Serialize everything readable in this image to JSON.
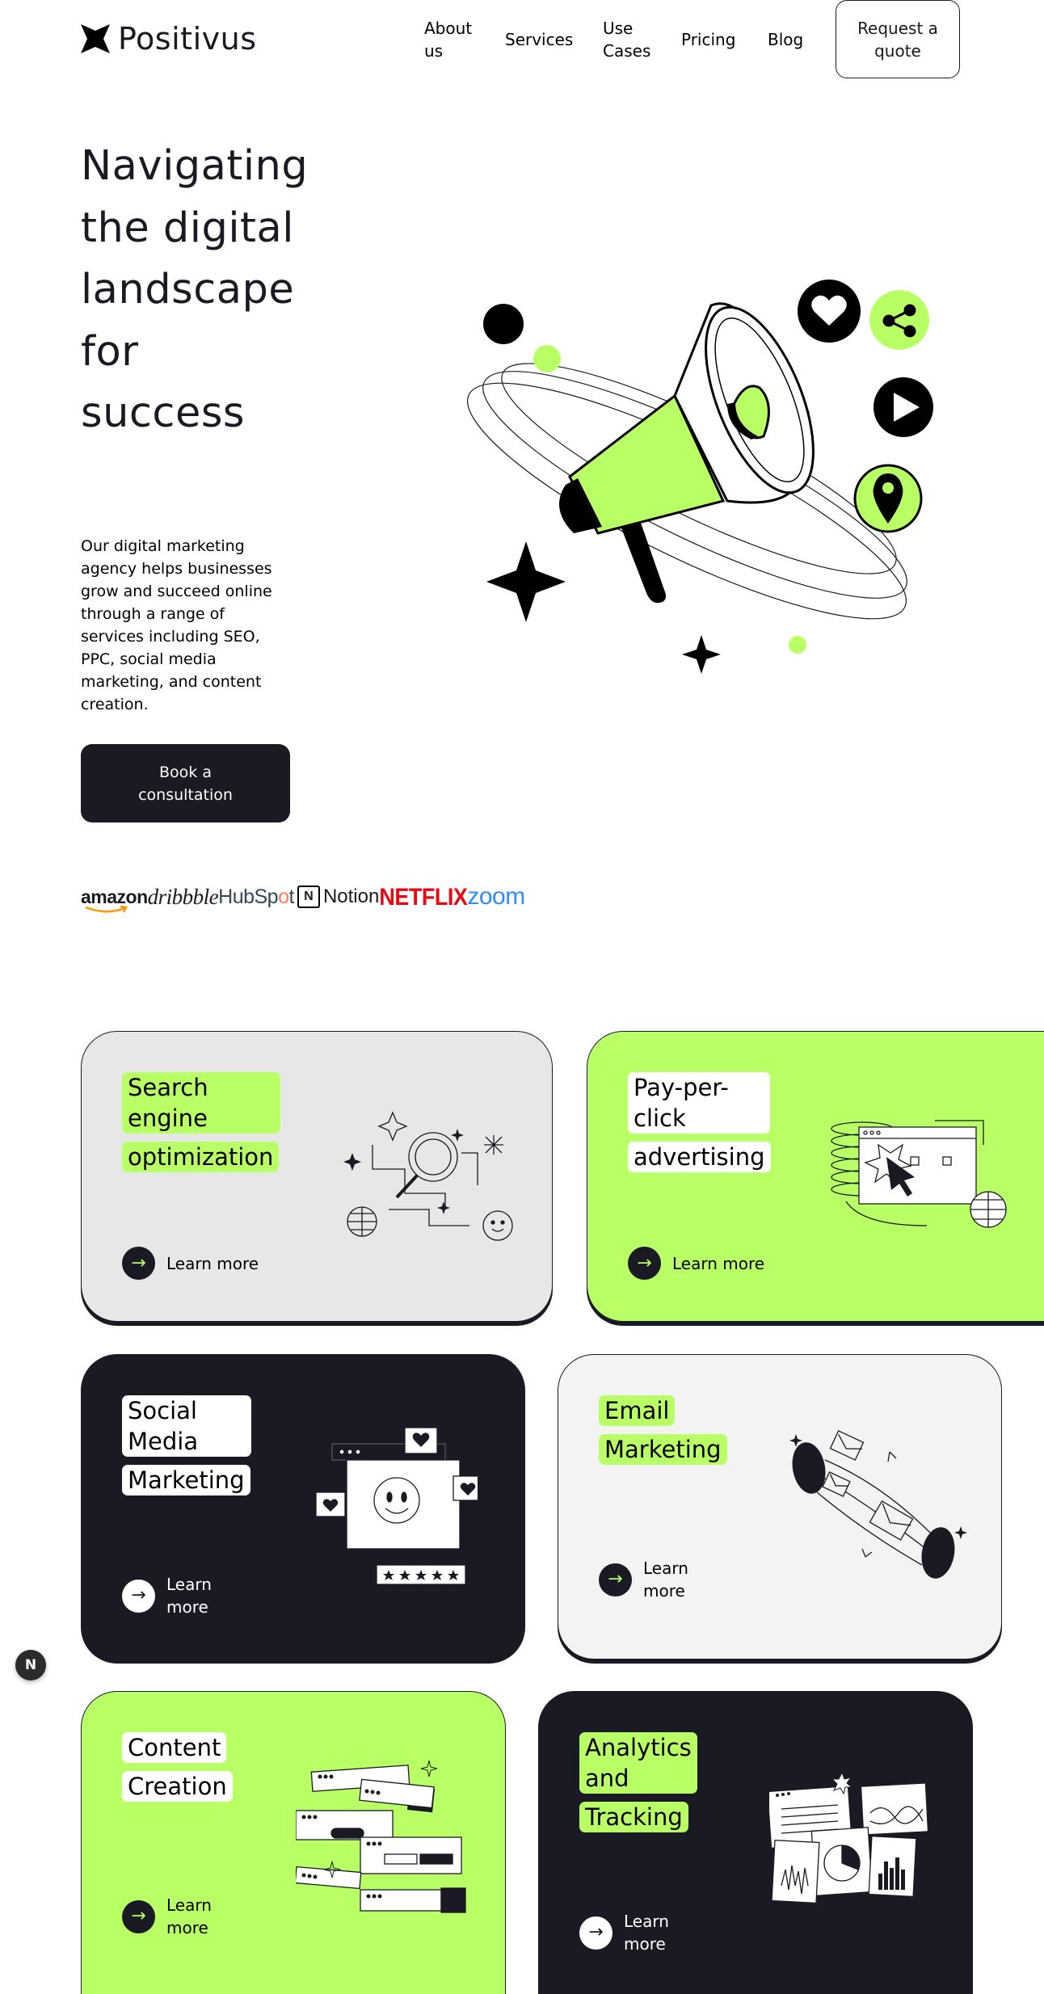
{
  "brand": {
    "name": "Positivus",
    "accent": "#b9ff66",
    "dark": "#191a23"
  },
  "nav": {
    "links": [
      "About\nus",
      "Services",
      "Use\nCases",
      "Pricing",
      "Blog"
    ],
    "cta": "Request a quote"
  },
  "hero": {
    "title": "Navigating the digital landscape for success",
    "description": "Our digital marketing agency helps businesses grow and succeed online through a range of services including SEO, PPC, social media marketing, and content creation.",
    "cta": "Book a consultation",
    "illustration": "megaphone-illustration"
  },
  "logos": {
    "amazon": "amazon",
    "dribbble": "dribbble",
    "hubspot_a": "HubSp",
    "hubspot_o": "o",
    "hubspot_b": "t",
    "notion_mark": "N",
    "notion": "Notion",
    "netflix": "NETFLIX",
    "zoom": "zoom"
  },
  "services": [
    {
      "title": [
        "Search engine",
        "optimization"
      ],
      "learn": "Learn more",
      "art": "seo-illustration"
    },
    {
      "title": [
        "Pay-per-click",
        "advertising"
      ],
      "learn": "Learn more",
      "art": "ppc-illustration"
    },
    {
      "title": [
        "Social Media",
        "Marketing"
      ],
      "learn": "Learn more",
      "art": "social-illustration"
    },
    {
      "title": [
        "Email",
        "Marketing"
      ],
      "learn": "Learn more",
      "art": "email-illustration"
    },
    {
      "title": [
        "Content",
        "Creation"
      ],
      "learn": "Learn more",
      "art": "content-illustration"
    },
    {
      "title": [
        "Analytics and",
        "Tracking"
      ],
      "learn": "Learn more",
      "art": "analytics-illustration"
    }
  ],
  "badge": {
    "letter": "N"
  }
}
